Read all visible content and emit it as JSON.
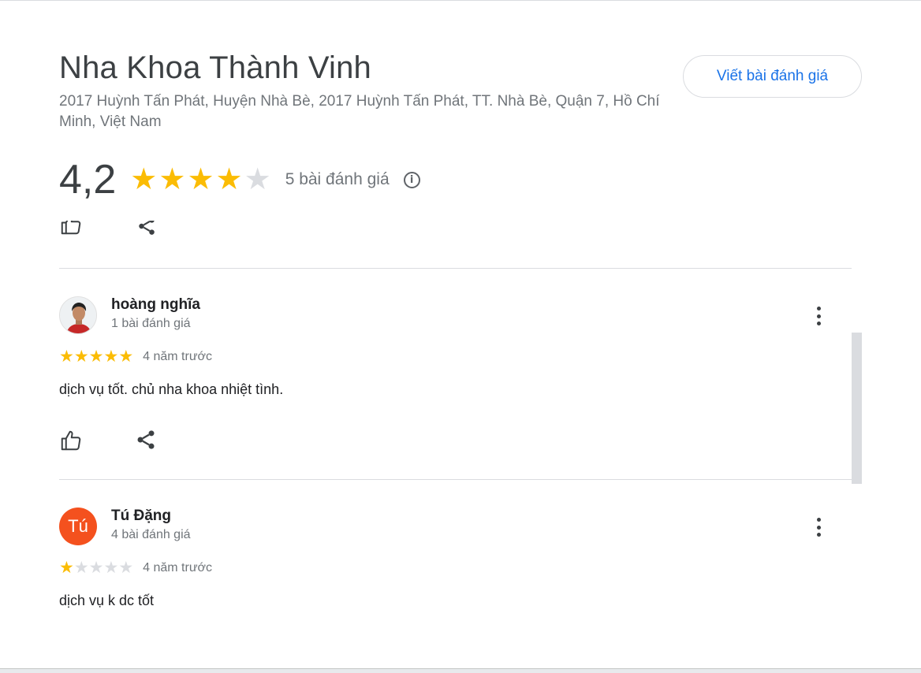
{
  "place": {
    "name": "Nha Khoa Thành Vinh",
    "address": "2017 Huỳnh Tấn Phát, Huyện Nhà Bè, 2017 Huỳnh Tấn Phát, TT. Nhà Bè, Quận 7, Hồ Chí Minh, Việt Nam",
    "write_review_label": "Viết bài đánh giá",
    "rating_value": "4,2",
    "rating_stars": 4,
    "review_count": "5 bài đánh giá",
    "info_icon": "info-icon"
  },
  "reviews": [
    {
      "name": "hoàng nghĩa",
      "meta": "1 bài đánh giá",
      "stars": 5,
      "time": "4 năm trước",
      "text": "dịch vụ tốt. chủ nha khoa nhiệt tình.",
      "avatar_type": "photo"
    },
    {
      "name": "Tú Đặng",
      "meta": "4 bài đánh giá",
      "stars": 1,
      "time": "4 năm trước",
      "text": "dịch vụ k dc tốt",
      "avatar_type": "letter",
      "avatar_letter": "Tú",
      "avatar_color": "#f4511e"
    }
  ],
  "colors": {
    "star_on": "#fbbc04",
    "star_off": "#dadce0",
    "accent": "#1a73e8"
  }
}
